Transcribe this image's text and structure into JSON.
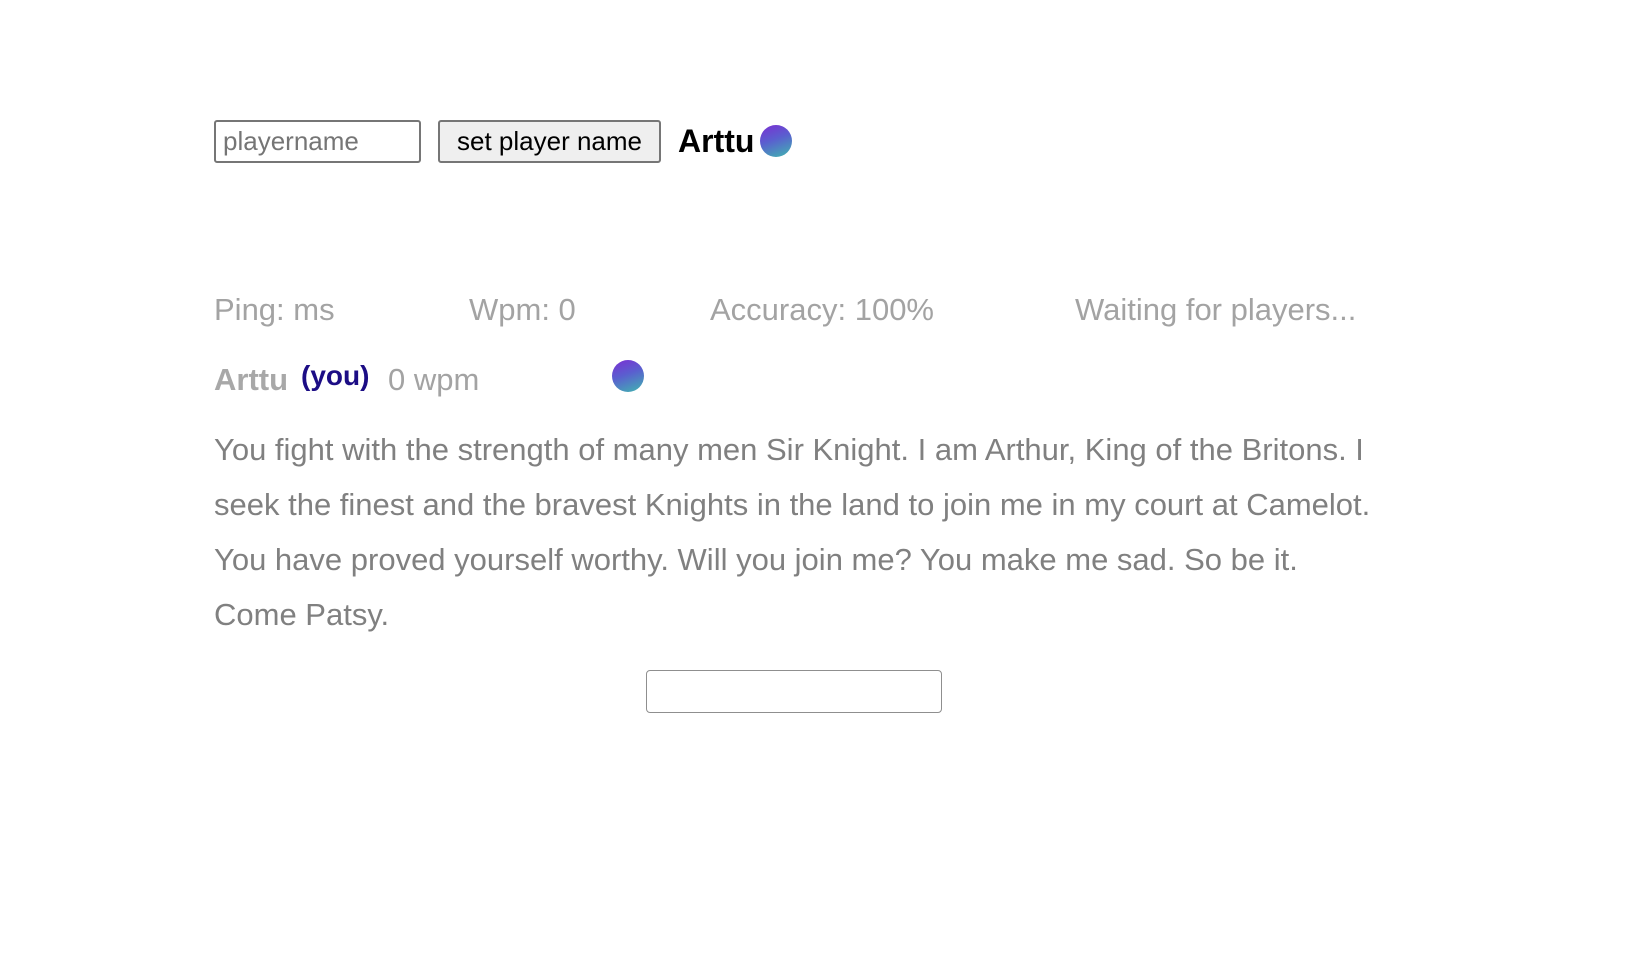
{
  "name_form": {
    "input_placeholder": "playername",
    "input_value": "",
    "button_label": "set player name",
    "current_name": "Arttu"
  },
  "stats": {
    "ping": "Ping: ms",
    "wpm": "Wpm: 0",
    "accuracy": "Accuracy: 100%",
    "status": "Waiting for players..."
  },
  "players": [
    {
      "name": "Arttu",
      "you_label": "(you)",
      "wpm": "0 wpm"
    }
  ],
  "passage": {
    "text": "You fight with the strength of many men Sir Knight. I am Arthur, King of the Britons. I seek the finest and the bravest Knights in the land to join me in my court at Camelot. You have proved yourself worthy. Will you join me? You make me sad. So be it. Come Patsy."
  },
  "typing_input": {
    "value": ""
  },
  "colors": {
    "orb_start": "#7b2fd3",
    "orb_end": "#3fb6b0",
    "you_label": "#1c0d85",
    "muted_text": "#a3a3a3",
    "passage_text": "#808080"
  },
  "icons": {
    "player_avatar": "gradient-orb-icon"
  }
}
